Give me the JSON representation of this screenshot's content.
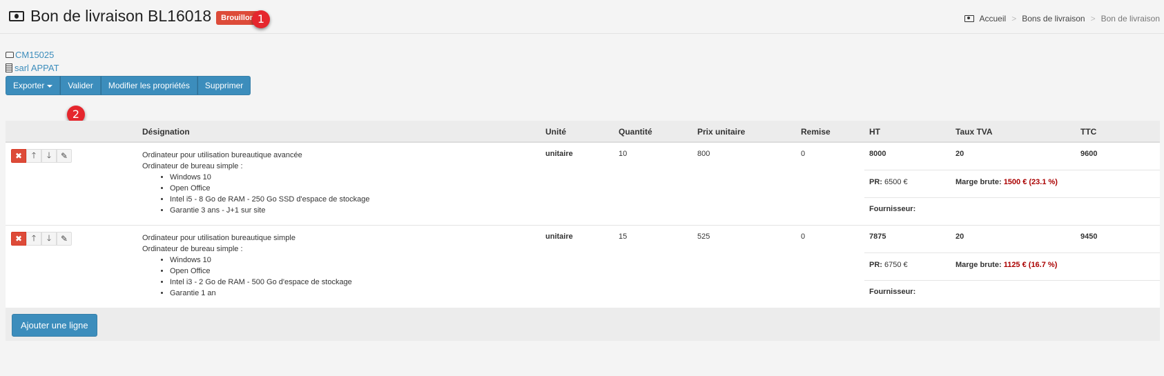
{
  "header": {
    "title": "Bon de livraison BL16018",
    "status_badge": "Brouillon",
    "marker_1": "1",
    "marker_2": "2",
    "breadcrumb": [
      "Accueil",
      "Bons de livraison",
      "Bon de livraison"
    ]
  },
  "links": {
    "order": "CM15025",
    "company": "sarl APPAT"
  },
  "toolbar": {
    "export_label": "Exporter",
    "validate_label": "Valider",
    "edit_props_label": "Modifier les propriétés",
    "delete_label": "Supprimer"
  },
  "table": {
    "columns": [
      "Désignation",
      "Unité",
      "Quantité",
      "Prix unitaire",
      "Remise",
      "HT",
      "Taux TVA",
      "TTC"
    ],
    "pr_label": "PR:",
    "margin_label": "Marge brute:",
    "supplier_label": "Fournisseur:",
    "rows": [
      {
        "title": "Ordinateur pour utilisation bureautique avancée",
        "subtitle": "Ordinateur de bureau simple :",
        "features": [
          "Windows 10",
          "Open Office",
          "Intel i5 - 8 Go de RAM - 250 Go SSD d'espace de stockage",
          "Garantie 3 ans - J+1 sur site"
        ],
        "unit": "unitaire",
        "qty": "10",
        "unit_price": "800",
        "discount": "0",
        "ht": "8000",
        "vat": "20",
        "ttc": "9600",
        "pr": "6500 €",
        "margin": "1500 € (23.1 %)"
      },
      {
        "title": "Ordinateur pour utilisation bureautique simple",
        "subtitle": "Ordinateur de bureau simple :",
        "features": [
          "Windows 10",
          "Open Office",
          "Intel i3 - 2 Go de RAM - 500 Go d'espace de stockage",
          "Garantie 1 an"
        ],
        "unit": "unitaire",
        "qty": "15",
        "unit_price": "525",
        "discount": "0",
        "ht": "7875",
        "vat": "20",
        "ttc": "9450",
        "pr": "6750 €",
        "margin": "1125 € (16.7 %)"
      }
    ],
    "add_line_label": "Ajouter une ligne"
  },
  "colors": {
    "primary": "#3c8dbc",
    "danger": "#dd4b39",
    "marker": "#e5262d",
    "margin_text": "#aa0000"
  }
}
